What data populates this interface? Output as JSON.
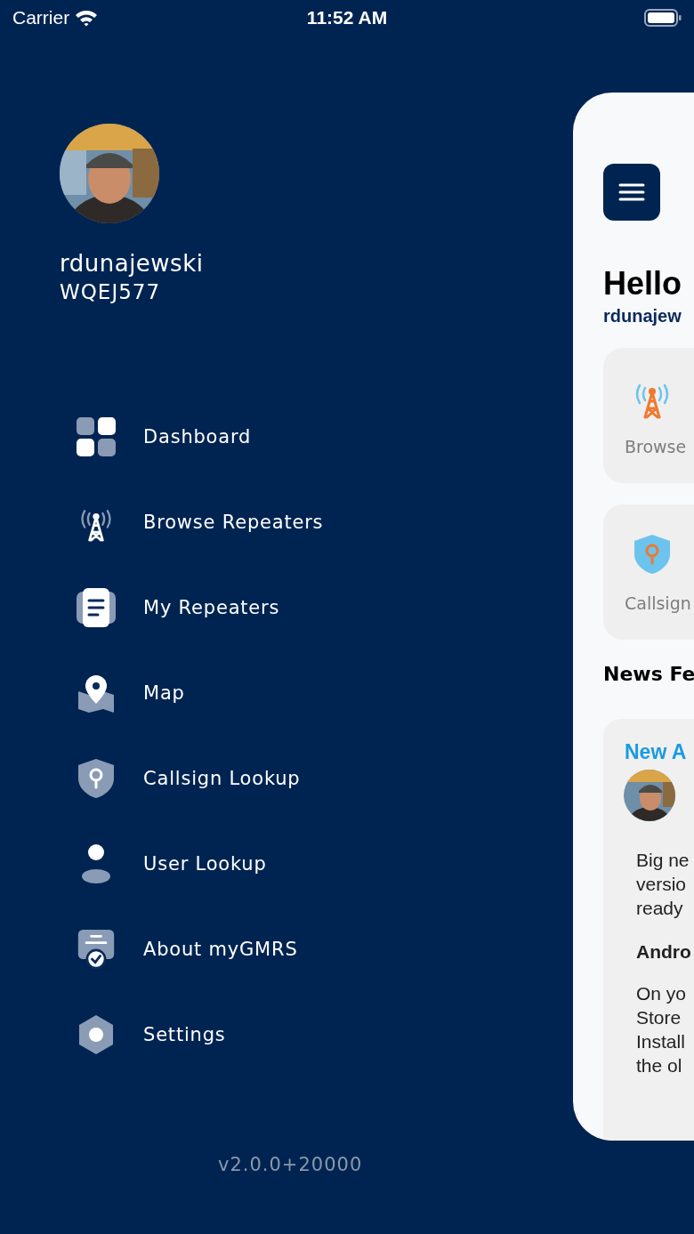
{
  "status_bar": {
    "carrier": "Carrier",
    "time": "11:52 AM"
  },
  "profile": {
    "username": "rdunajewski",
    "callsign": "WQEJ577"
  },
  "menu": [
    {
      "label": "Dashboard",
      "kind": "grid"
    },
    {
      "label": "Browse Repeaters",
      "kind": "tower"
    },
    {
      "label": "My Repeaters",
      "kind": "document"
    },
    {
      "label": "Map",
      "kind": "map"
    },
    {
      "label": "Callsign Lookup",
      "kind": "shield"
    },
    {
      "label": "User Lookup",
      "kind": "user"
    },
    {
      "label": "About myGMRS",
      "kind": "badge"
    },
    {
      "label": "Settings",
      "kind": "gear"
    }
  ],
  "version": "v2.0.0+20000",
  "dashboard": {
    "greeting": "Hello",
    "username": "rdunajew",
    "tiles": [
      {
        "label": "Browse",
        "kind": "tower"
      },
      {
        "label": "Callsign",
        "kind": "shield"
      }
    ],
    "news_title": "News Fe",
    "post": {
      "title": "New A",
      "paragraphs": [
        {
          "kind": "text",
          "lines": [
            "Big ne",
            "versio",
            "ready"
          ]
        },
        {
          "kind": "heading",
          "lines": [
            "Andro"
          ]
        },
        {
          "kind": "text",
          "lines": [
            "On yo",
            "Store",
            "Install",
            "the ol"
          ]
        }
      ]
    }
  }
}
